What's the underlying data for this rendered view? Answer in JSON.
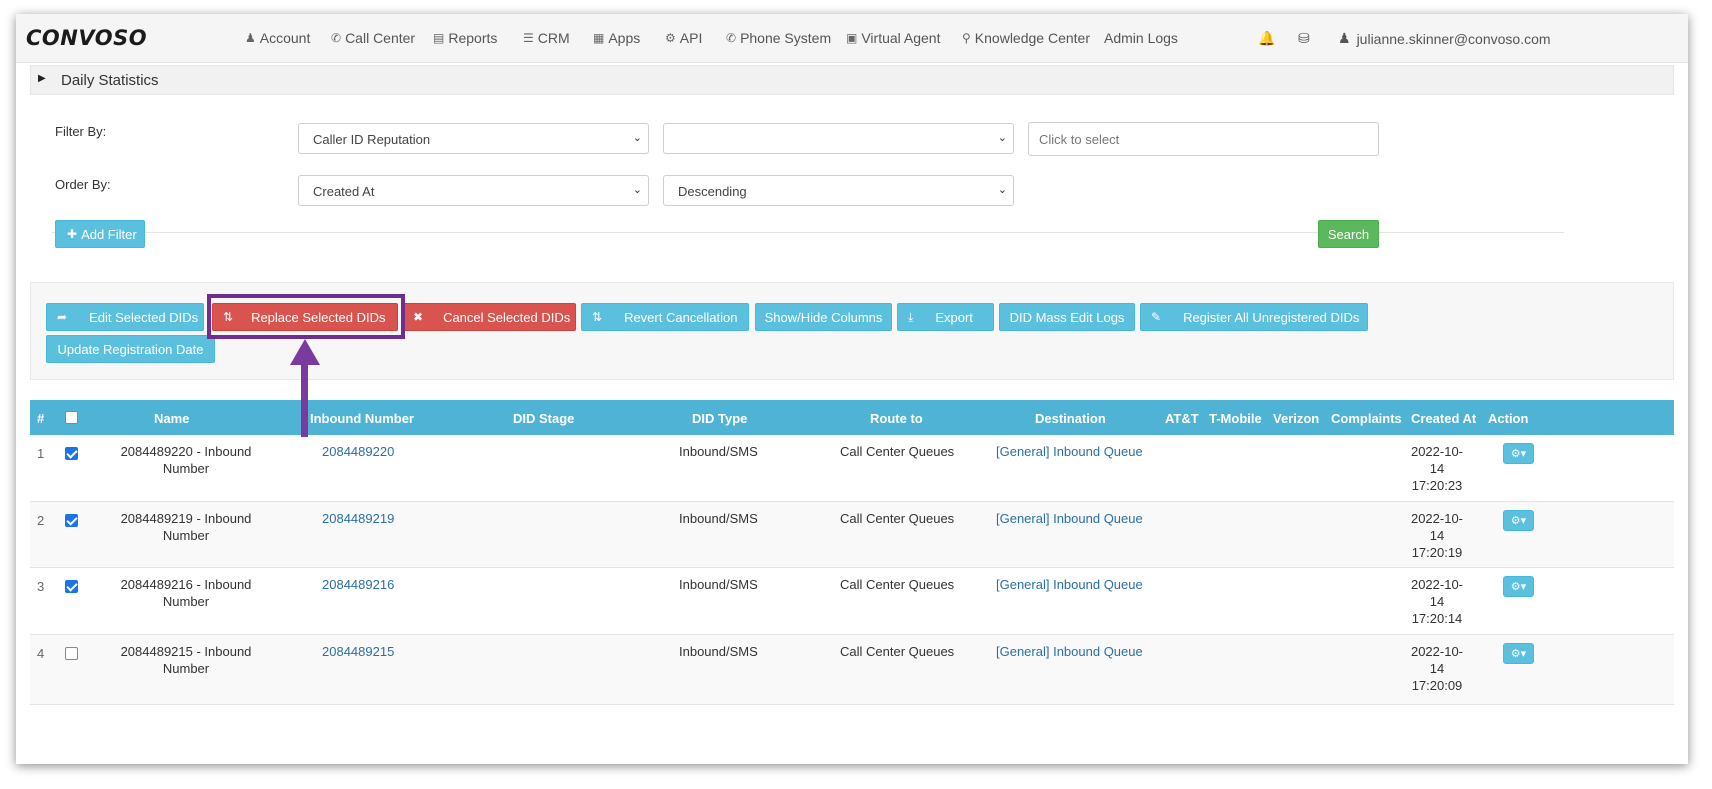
{
  "brand": {
    "logo_text": "CONVOSO"
  },
  "nav": {
    "items": [
      {
        "label": "Account",
        "icon": "user-icon"
      },
      {
        "label": "Call Center",
        "icon": "phone-icon"
      },
      {
        "label": "Reports",
        "icon": "bar-chart-icon"
      },
      {
        "label": "CRM",
        "icon": "list-icon"
      },
      {
        "label": "Apps",
        "icon": "grid-icon"
      },
      {
        "label": "API",
        "icon": "gear-icon"
      },
      {
        "label": "Phone System",
        "icon": "phone-icon"
      },
      {
        "label": "Virtual Agent",
        "icon": "monitor-icon"
      },
      {
        "label": "Knowledge Center",
        "icon": "lightbulb-icon"
      },
      {
        "label": "Admin Logs",
        "icon": ""
      }
    ],
    "user_email": "julianne.skinner@convoso.com"
  },
  "daily_statistics": {
    "title": "Daily Statistics"
  },
  "filters": {
    "filter_by_label": "Filter By:",
    "filter_by_value": "Caller ID Reputation",
    "filter_second_value": "",
    "filter_third_placeholder": "Click to select",
    "order_by_label": "Order By:",
    "order_by_value": "Created At",
    "order_direction_value": "Descending",
    "add_filter_label": "Add Filter",
    "search_label": "Search"
  },
  "actions": {
    "edit_selected": "Edit Selected DIDs",
    "replace_selected": "Replace Selected DIDs",
    "cancel_selected": "Cancel Selected DIDs",
    "revert_cancellation": "Revert Cancellation",
    "show_hide_columns": "Show/Hide Columns",
    "export": "Export",
    "mass_edit_logs": "DID Mass Edit Logs",
    "register_all": "Register All Unregistered DIDs",
    "update_registration": "Update Registration Date"
  },
  "table": {
    "headers": {
      "num": "#",
      "name": "Name",
      "inbound": "Inbound Number",
      "stage": "DID Stage",
      "type": "DID Type",
      "route": "Route to",
      "destination": "Destination",
      "att": "AT&T",
      "tmobile": "T-Mobile",
      "verizon": "Verizon",
      "complaints": "Complaints",
      "created": "Created At",
      "action": "Action"
    },
    "rows": [
      {
        "num": "1",
        "checked": true,
        "name1": "2084489220 - Inbound",
        "name2": "Number",
        "inbound": "2084489220",
        "stage": "",
        "type": "Inbound/SMS",
        "route": "Call Center Queues",
        "destination": "[General] Inbound Queue",
        "created1": "2022-10-",
        "created2": "14",
        "created3": "17:20:23"
      },
      {
        "num": "2",
        "checked": true,
        "name1": "2084489219 - Inbound",
        "name2": "Number",
        "inbound": "2084489219",
        "stage": "",
        "type": "Inbound/SMS",
        "route": "Call Center Queues",
        "destination": "[General] Inbound Queue",
        "created1": "2022-10-",
        "created2": "14",
        "created3": "17:20:19"
      },
      {
        "num": "3",
        "checked": true,
        "name1": "2084489216 - Inbound",
        "name2": "Number",
        "inbound": "2084489216",
        "stage": "",
        "type": "Inbound/SMS",
        "route": "Call Center Queues",
        "destination": "[General] Inbound Queue",
        "created1": "2022-10-",
        "created2": "14",
        "created3": "17:20:14"
      },
      {
        "num": "4",
        "checked": false,
        "name1": "2084489215 - Inbound",
        "name2": "Number",
        "inbound": "2084489215",
        "stage": "",
        "type": "Inbound/SMS",
        "route": "Call Center Queues",
        "destination": "[General] Inbound Queue",
        "created1": "2022-10-",
        "created2": "14",
        "created3": "17:20:09"
      }
    ]
  },
  "colors": {
    "info": "#5bc0de",
    "success": "#5cb85c",
    "danger": "#d9534f",
    "annotation": "#6f2d91",
    "table_header": "#4fb3d6"
  }
}
